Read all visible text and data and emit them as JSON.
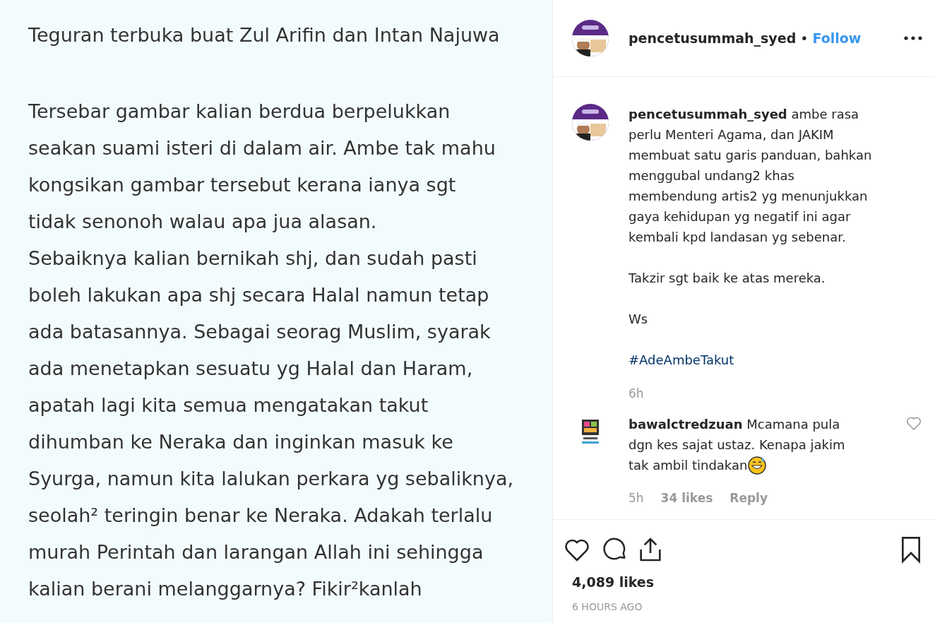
{
  "post_image": {
    "title": "Teguran terbuka buat Zul Arifin dan Intan Najuwa",
    "lines": [
      "Tersebar gambar kalian berdua berpelukkan",
      "seakan suami isteri di dalam air. Ambe tak mahu",
      "kongsikan gambar tersebut kerana ianya sgt",
      "tidak senonoh walau apa jua alasan.",
      "Sebaiknya kalian bernikah shj, dan sudah pasti",
      "boleh lakukan apa shj secara Halal namun tetap",
      "ada batasannya. Sebagai seorag Muslim, syarak",
      "ada menetapkan sesuatu yg Halal dan Haram,",
      "apatah lagi kita semua mengatakan takut",
      "dihumban ke Neraka dan inginkan masuk ke",
      "Syurga, namun kita lalukan perkara yg sebaliknya,",
      "seolah² teringin benar ke Neraka. Adakah terlalu",
      "murah Perintah dan larangan Allah ini sehingga",
      "kalian berani melanggarnya? Fikir²kanlah"
    ]
  },
  "header": {
    "username": "pencetusummah_syed",
    "separator": "•",
    "follow": "Follow"
  },
  "caption": {
    "lines": [
      "**pencetusummah_syed** ambe rasa",
      "perlu Menteri Agama, dan JAKIM",
      "membuat satu garis panduan, bahkan",
      "menggubal undang2 khas",
      "membendung artis2 yg menunjukkan",
      "gaya kehidupan yg negatif ini agar",
      "kembali kpd landasan yg sebenar."
    ],
    "paragraphs": [
      "Takzir sgt baik ke atas mereka.",
      "Ws"
    ],
    "hashtag": "#AdeAmbeTakut",
    "time": "6h"
  },
  "comments": [
    {
      "lines": [
        "**bawalctredzuan** Mcamana pula",
        "dgn kes sajat ustaz. Kenapa jakim",
        "tak ambil tindakan"
      ],
      "time": "5h",
      "likes": "34 likes",
      "reply": "Reply",
      "liked": false
    }
  ],
  "actions": {
    "liked": false,
    "saved": false
  },
  "likes": "4,089 likes",
  "posted": "6 HOURS AGO"
}
